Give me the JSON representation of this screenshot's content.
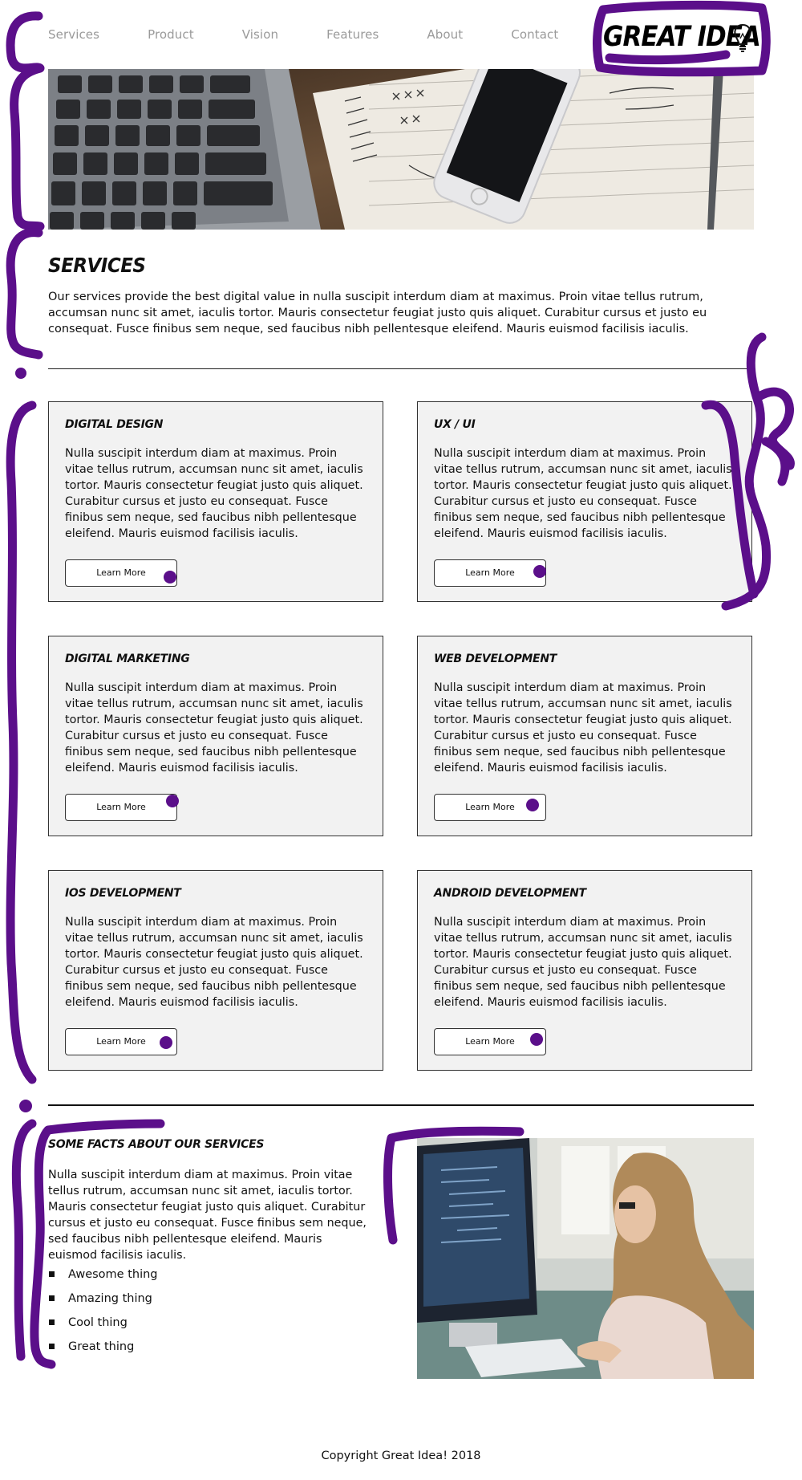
{
  "nav": {
    "items": [
      "Services",
      "Product",
      "Vision",
      "Features",
      "About",
      "Contact"
    ]
  },
  "logo": {
    "text": "GREAT IDEA",
    "icon": "lightbulb-icon"
  },
  "colors": {
    "accent": "#5b0f8a",
    "card_bg": "#f2f2f2",
    "nav_text": "#9a9a9a"
  },
  "services": {
    "title": "SERVICES",
    "intro": "Our services provide the best digital value in nulla suscipit interdum diam at maximus. Proin vitae tellus rutrum, accumsan nunc sit amet, iaculis tortor. Mauris consectetur feugiat justo quis aliquet. Curabitur cursus et justo eu consequat. Fusce finibus sem neque, sed faucibus nibh pellentesque eleifend. Mauris euismod facilisis iaculis."
  },
  "cards": [
    {
      "title": "DIGITAL DESIGN",
      "text": "Nulla suscipit interdum diam at maximus. Proin vitae tellus rutrum, accumsan nunc sit amet, iaculis tortor. Mauris consectetur feugiat justo quis aliquet. Curabitur cursus et justo eu consequat. Fusce finibus sem neque, sed faucibus nibh pellentesque eleifend. Mauris euismod facilisis iaculis.",
      "button": "Learn More"
    },
    {
      "title": "UX / UI",
      "text": "Nulla suscipit interdum diam at maximus. Proin vitae tellus rutrum, accumsan nunc sit amet, iaculis tortor. Mauris consectetur feugiat justo quis aliquet. Curabitur cursus et justo eu consequat. Fusce finibus sem neque, sed faucibus nibh pellentesque eleifend. Mauris euismod facilisis iaculis.",
      "button": "Learn More"
    },
    {
      "title": "DIGITAL MARKETING",
      "text": "Nulla suscipit interdum diam at maximus. Proin vitae tellus rutrum, accumsan nunc sit amet, iaculis tortor. Mauris consectetur feugiat justo quis aliquet. Curabitur cursus et justo eu consequat. Fusce finibus sem neque, sed faucibus nibh pellentesque eleifend. Mauris euismod facilisis iaculis.",
      "button": "Learn More"
    },
    {
      "title": "WEB DEVELOPMENT",
      "text": "Nulla suscipit interdum diam at maximus. Proin vitae tellus rutrum, accumsan nunc sit amet, iaculis tortor. Mauris consectetur feugiat justo quis aliquet. Curabitur cursus et justo eu consequat. Fusce finibus sem neque, sed faucibus nibh pellentesque eleifend. Mauris euismod facilisis iaculis.",
      "button": "Learn More"
    },
    {
      "title": "IOS DEVELOPMENT",
      "text": "Nulla suscipit interdum diam at maximus. Proin vitae tellus rutrum, accumsan nunc sit amet, iaculis tortor. Mauris consectetur feugiat justo quis aliquet. Curabitur cursus et justo eu consequat. Fusce finibus sem neque, sed faucibus nibh pellentesque eleifend. Mauris euismod facilisis iaculis.",
      "button": "Learn More"
    },
    {
      "title": "ANDROID DEVELOPMENT",
      "text": "Nulla suscipit interdum diam at maximus. Proin vitae tellus rutrum, accumsan nunc sit amet, iaculis tortor. Mauris consectetur feugiat justo quis aliquet. Curabitur cursus et justo eu consequat. Fusce finibus sem neque, sed faucibus nibh pellentesque eleifend. Mauris euismod facilisis iaculis.",
      "button": "Learn More"
    }
  ],
  "facts": {
    "title": "SOME FACTS ABOUT OUR SERVICES",
    "text": "Nulla suscipit interdum diam at maximus. Proin vitae tellus rutrum, accumsan nunc sit amet, iaculis tortor. Mauris consectetur feugiat justo quis aliquet. Curabitur cursus et justo eu consequat. Fusce finibus sem neque, sed faucibus nibh pellentesque eleifend. Mauris euismod facilisis iaculis.",
    "list": [
      "Awesome thing",
      "Amazing thing",
      "Cool thing",
      "Great thing"
    ]
  },
  "footer": {
    "copyright": "Copyright Great Idea! 2018"
  }
}
